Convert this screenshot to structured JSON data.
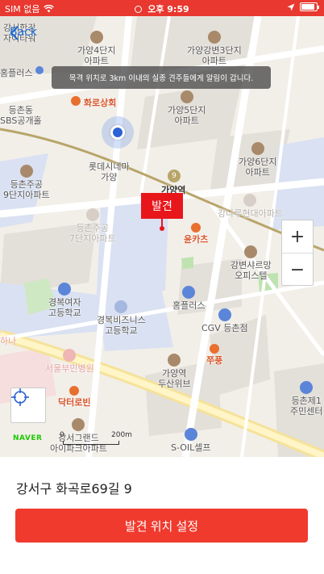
{
  "status_bar": {
    "carrier": "SIM 없음",
    "time": "오후 9:59"
  },
  "nav": {
    "back_label": "Back"
  },
  "toast": {
    "message": "목격 위치로 3km 이내의 실종 견주들에게 알림이 갑니다."
  },
  "marker": {
    "label": "발견"
  },
  "map_labels": {
    "gangseo_ga": "강서한강\n자이타워",
    "homeplus_top": "홈플러스",
    "gayang4": "가양4단지\n아파트",
    "gayanggangbyeon3": "가양강변3단지\n아파트",
    "gayang5": "가양5단지\n아파트",
    "hwaro": "화로상회",
    "deungchon": "등촌동\nSBS공개홀",
    "gayang6": "가양6단지\n아파트",
    "lotte": "롯데시네마\n가양",
    "deungchon9": "등촌주공\n9단지아파트",
    "gayang_station": "가양역",
    "deungchon7": "등촌주공\n7단지아파트",
    "gangnamu": "강나루현대아파트",
    "yunkas": "윤카츠",
    "gangbyeonsharm": "강변샤르망\n오피스텔",
    "gyeongbok_girls": "경복여자\n고등학교",
    "gyeongbok_biz": "경복비즈니스\n고등학교",
    "homeplus_mid": "홈플러스",
    "cgv": "CGV 등촌점",
    "jjupoong": "쭈풍",
    "seoul_bu": "서울부민병원",
    "gayang_duwee": "가양역\n두산위브",
    "doctor_robin": "닥터로빈",
    "gangseo_grand": "강서그랜드\n아이파크아파트",
    "soil": "S-OIL셀프",
    "deungchon1": "등촌제1\n주민센터",
    "line9": "9",
    "hana": "하나"
  },
  "map_controls": {
    "zoom_in": "+",
    "zoom_out": "−",
    "brand": "NAVER",
    "scale_start": "0",
    "scale_end": "200m"
  },
  "panel": {
    "address": "강서구 화곡로69길 9",
    "button_label": "발견 위치 설정"
  },
  "colors": {
    "status_bar": "#e8382f",
    "primary_button": "#f03a2e",
    "marker": "#e8161b",
    "link": "#1f6dd8"
  }
}
